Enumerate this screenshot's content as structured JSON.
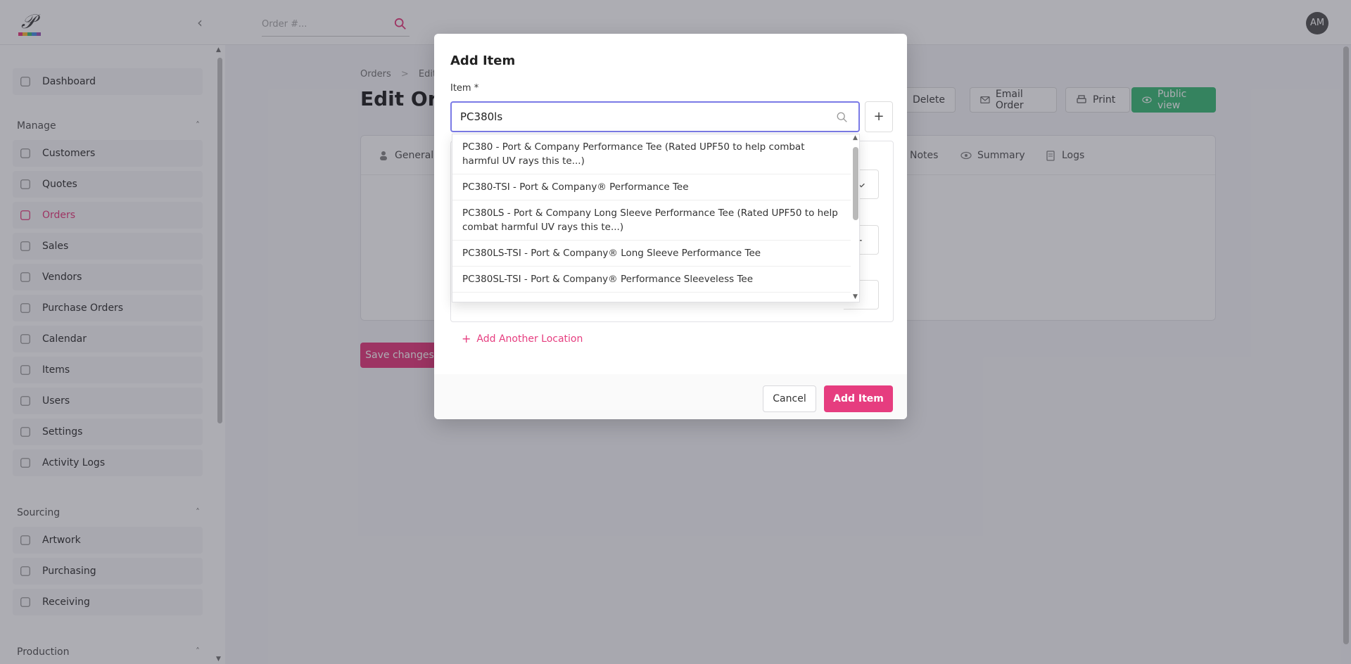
{
  "topbar": {
    "search_placeholder": "Order #...",
    "avatar_initials": "AM"
  },
  "sidebar": {
    "items_top": [
      {
        "label": "Dashboard",
        "icon": "chart-pie-icon"
      }
    ],
    "sections": [
      {
        "title": "Manage",
        "items": [
          {
            "label": "Customers",
            "icon": "heart-icon"
          },
          {
            "label": "Quotes",
            "icon": "document-icon"
          },
          {
            "label": "Orders",
            "icon": "box-icon",
            "active": true
          },
          {
            "label": "Sales",
            "icon": "dollar-icon"
          },
          {
            "label": "Vendors",
            "icon": "building-icon"
          },
          {
            "label": "Purchase Orders",
            "icon": "cart-icon"
          },
          {
            "label": "Calendar",
            "icon": "calendar-icon"
          },
          {
            "label": "Items",
            "icon": "cart-icon"
          },
          {
            "label": "Users",
            "icon": "users-icon"
          },
          {
            "label": "Settings",
            "icon": "gear-icon"
          },
          {
            "label": "Activity Logs",
            "icon": "clipboard-icon"
          }
        ]
      },
      {
        "title": "Sourcing",
        "items": [
          {
            "label": "Artwork",
            "icon": "image-icon"
          },
          {
            "label": "Purchasing",
            "icon": "money-icon"
          },
          {
            "label": "Receiving",
            "icon": "box-icon"
          }
        ]
      },
      {
        "title": "Production",
        "items": []
      }
    ]
  },
  "page": {
    "breadcrumb_root": "Orders",
    "breadcrumb_sep": ">",
    "breadcrumb_current": "Edit",
    "title": "Edit Orc",
    "buttons": {
      "delete": "Delete",
      "email": "Email Order",
      "print": "Print",
      "public": "Public view"
    },
    "tabs": [
      "General",
      "Notes",
      "Summary",
      "Logs"
    ],
    "save_label": "Save changes"
  },
  "modal": {
    "title": "Add Item",
    "item_label": "Item *",
    "item_value": "PC380ls",
    "add_small": "+",
    "add_location": "Add Another Location",
    "cancel": "Cancel",
    "submit": "Add Item",
    "plus_symbol": "+"
  },
  "dropdown": {
    "options": [
      "PC380 - Port & Company Performance Tee (Rated UPF50 to help combat harmful UV rays this te...)",
      "PC380-TSI - Port & Company® Performance Tee",
      "PC380LS - Port & Company Long Sleeve Performance Tee (Rated UPF50 to help combat harmful UV rays this te...)",
      "PC380LS-TSI - Port & Company® Long Sleeve Performance Tee",
      "PC380SL-TSI - Port & Company® Performance Sleeveless Tee"
    ]
  },
  "colors": {
    "accent": "#e63d7f",
    "public_view": "#3ebc78",
    "input_focus": "#7a7ae6",
    "overlay": "rgba(40,40,55,0.38)"
  }
}
